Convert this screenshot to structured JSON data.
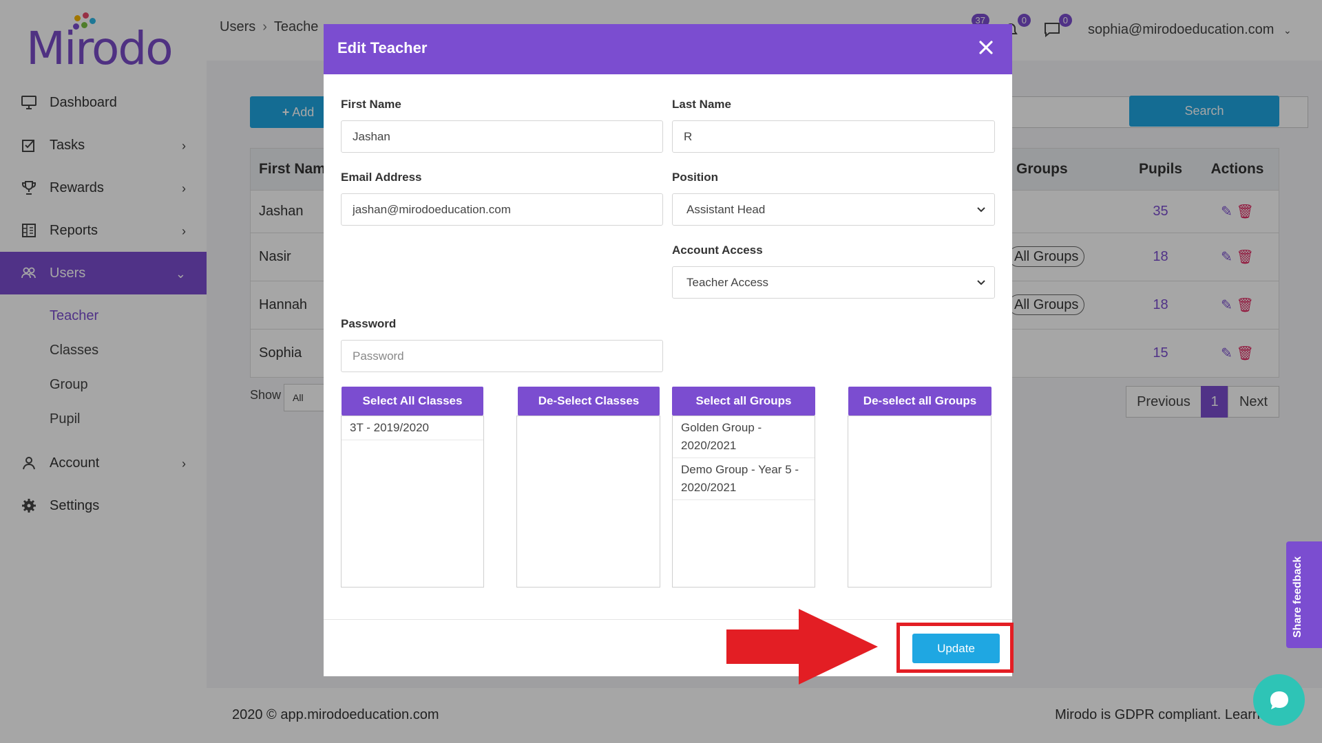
{
  "app": {
    "logo_text": "Mirodo"
  },
  "sidebar": {
    "items": [
      {
        "label": "Dashboard",
        "icon": "monitor-icon"
      },
      {
        "label": "Tasks",
        "icon": "tasks-icon"
      },
      {
        "label": "Rewards",
        "icon": "trophy-icon"
      },
      {
        "label": "Reports",
        "icon": "reports-icon"
      },
      {
        "label": "Users",
        "icon": "users-icon"
      },
      {
        "label": "Account",
        "icon": "account-icon"
      },
      {
        "label": "Settings",
        "icon": "gear-icon"
      }
    ],
    "sub_items": [
      "Teacher",
      "Classes",
      "Group",
      "Pupil"
    ]
  },
  "header": {
    "breadcrumb": [
      "Users",
      "Teache"
    ],
    "notifications": [
      "37",
      "0",
      "0"
    ],
    "user_email": "sophia@mirodoeducation.com"
  },
  "background": {
    "add_button": "Add",
    "search_button": "Search",
    "table": {
      "columns": [
        "First Nam",
        "Groups",
        "Pupils",
        "Actions"
      ],
      "rows": [
        {
          "first": "Jashan",
          "groups": "",
          "pupils": "35"
        },
        {
          "first": "Nasir",
          "groups": "All Groups",
          "pupils": "18"
        },
        {
          "first": "Hannah",
          "groups": "All Groups",
          "pupils": "18"
        },
        {
          "first": "Sophia",
          "groups": "",
          "pupils": "15"
        }
      ]
    },
    "show_label": "Show",
    "show_value": "All",
    "pager": {
      "prev": "Previous",
      "page": "1",
      "next": "Next"
    },
    "footer_left": "2020 © app.mirodoeducation.com",
    "footer_right": "Mirodo is GDPR compliant. Learn"
  },
  "modal": {
    "title": "Edit Teacher",
    "first_name_label": "First Name",
    "first_name_value": "Jashan",
    "last_name_label": "Last Name",
    "last_name_value": "R",
    "email_label": "Email Address",
    "email_value": "jashan@mirodoeducation.com",
    "position_label": "Position",
    "position_value": "Assistant Head",
    "access_label": "Account Access",
    "access_value": "Teacher Access",
    "password_label": "Password",
    "password_placeholder": "Password",
    "select_all_classes": "Select All Classes",
    "deselect_classes": "De-Select Classes",
    "select_all_groups": "Select all Groups",
    "deselect_all_groups": "De-select all Groups",
    "classes_options": [
      "3T - 2019/2020"
    ],
    "groups_options": [
      "Golden Group - 2020/2021",
      "Demo Group - Year 5 - 2020/2021"
    ],
    "update_button": "Update"
  },
  "floating": {
    "feedback": "Share feedback"
  },
  "colors": {
    "accent": "#7b4dd0",
    "update": "#1fa7e2",
    "highlight": "#e31e24"
  }
}
